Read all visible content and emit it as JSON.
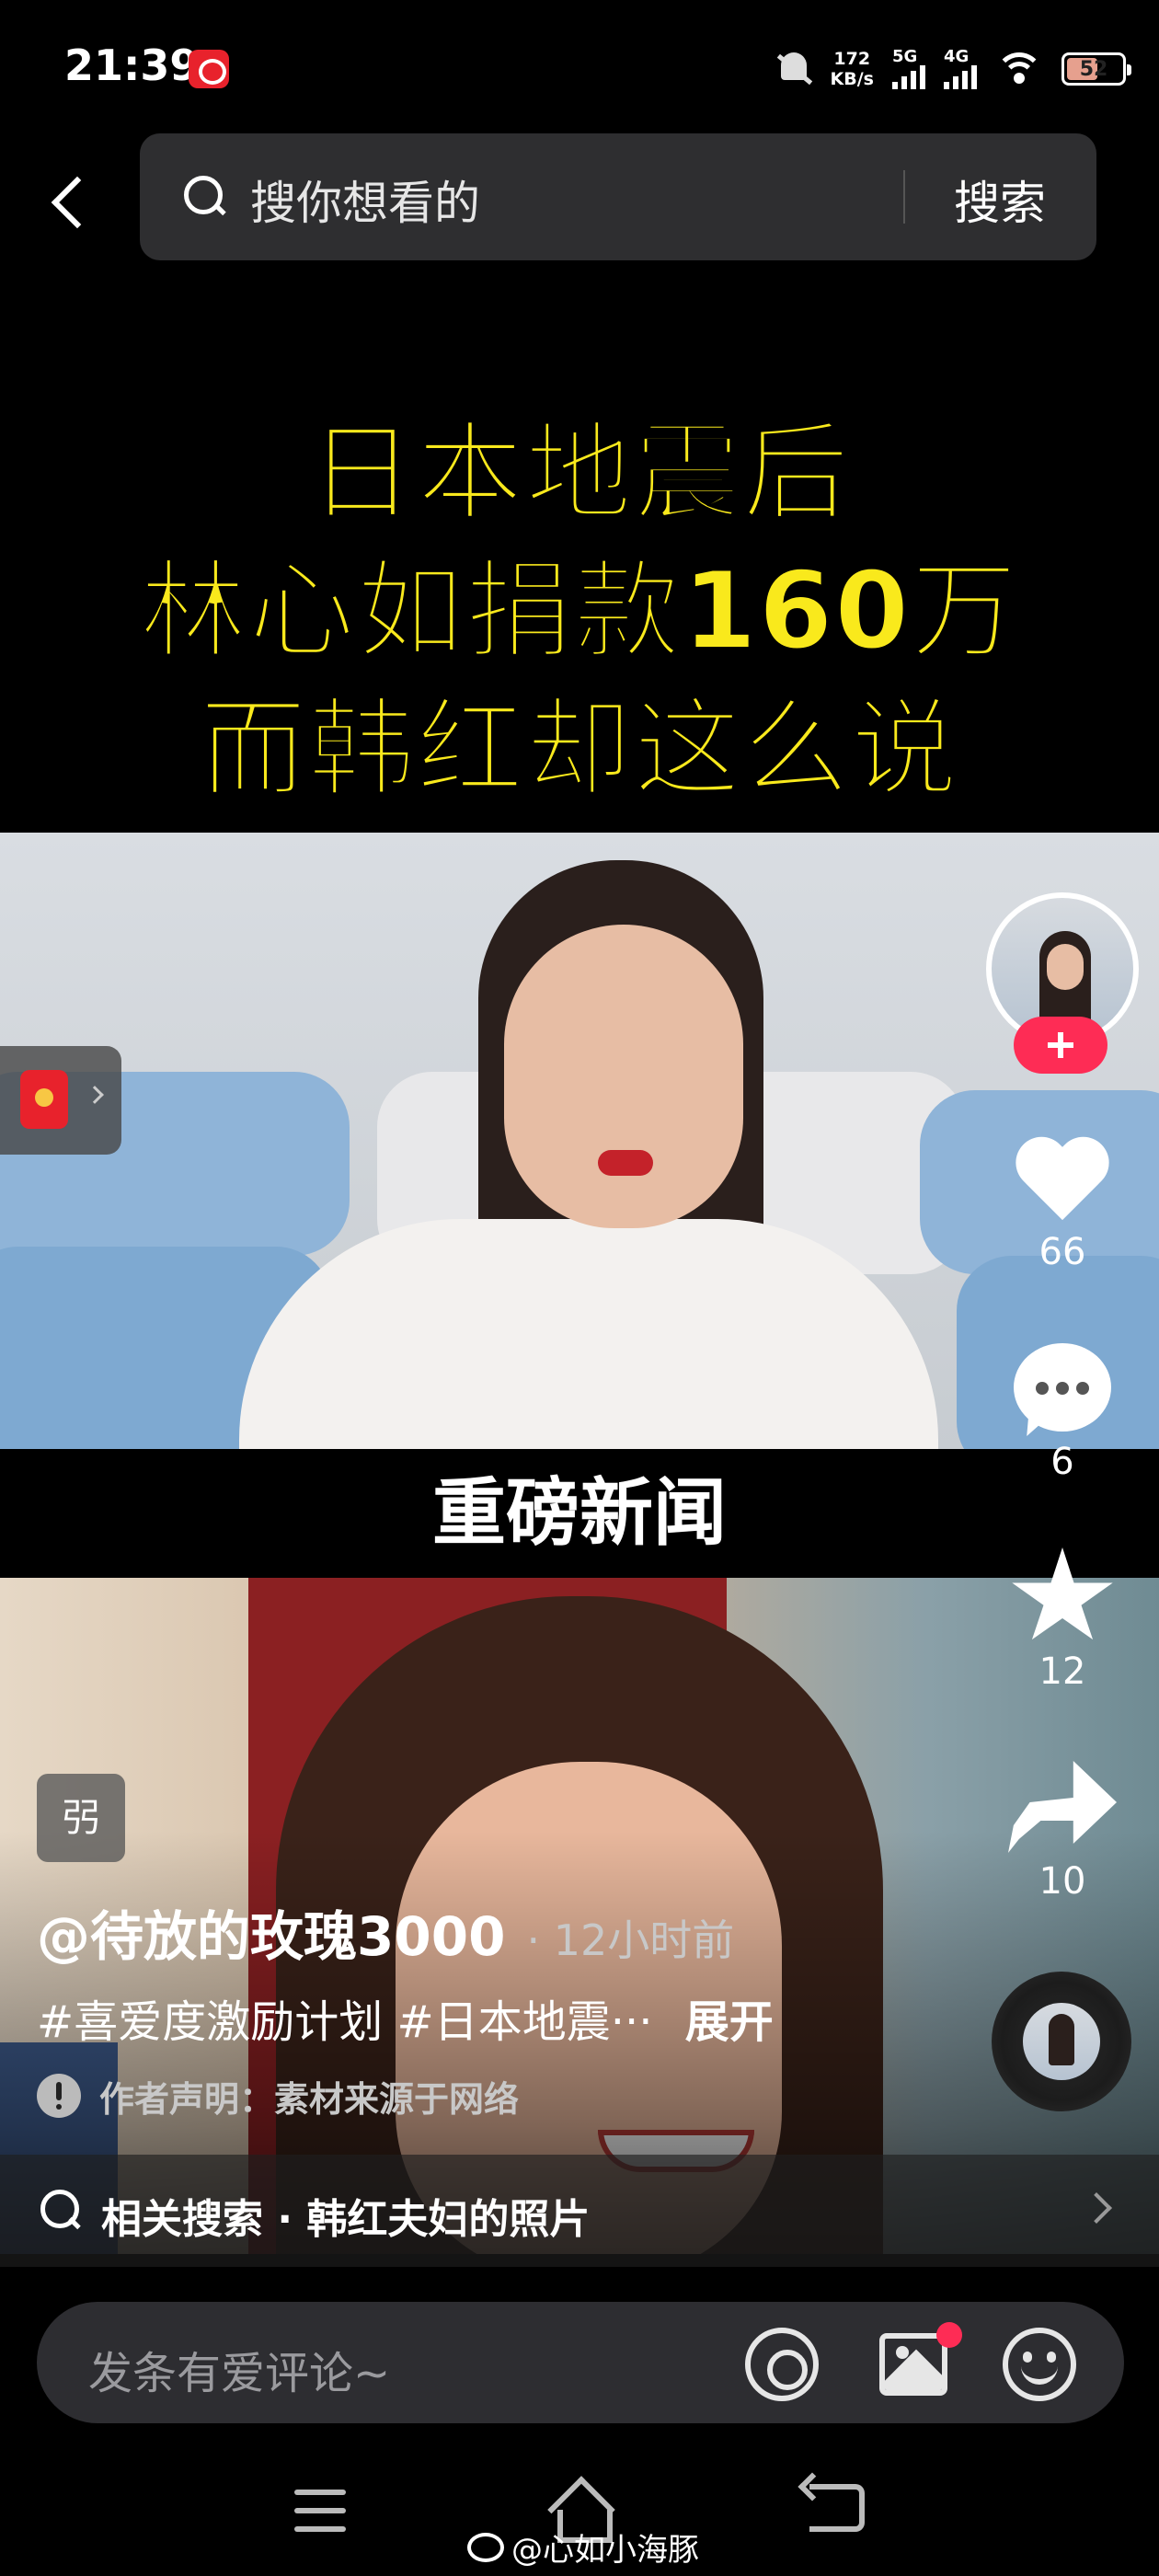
{
  "status_bar": {
    "time": "21:39",
    "net_speed_value": "172",
    "net_speed_unit": "KB/s",
    "signal_1_label": "5G",
    "signal_2_label": "4G",
    "battery": "52"
  },
  "search": {
    "placeholder": "搜你想看的",
    "submit_label": "搜索"
  },
  "video": {
    "headline_line1": "日本地震后",
    "headline_line2": "林心如捐款160万",
    "headline_line3": "而韩红却这么说",
    "caption": "重磅新闻"
  },
  "rail": {
    "likes": "66",
    "comments": "6",
    "favorites": "12",
    "shares": "10"
  },
  "post": {
    "tag_badge": "弜",
    "author": "@待放的玫瑰3000",
    "time": "· 12小时前",
    "description": "#喜爱度激励计划 #日本地震···",
    "expand": "展开",
    "notice": "作者声明：素材来源于网络",
    "related_search": "相关搜索 · 韩红夫妇的照片"
  },
  "comment_bar": {
    "placeholder": "发条有爱评论~"
  },
  "watermark": "@心如小海豚"
}
